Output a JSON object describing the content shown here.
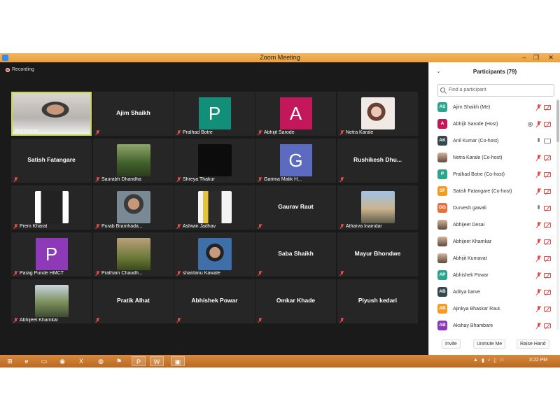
{
  "window": {
    "title": "Zoom Meeting",
    "minimize": "–",
    "maximize": "❐",
    "close": "✕"
  },
  "meeting": {
    "recording_label": "Recording"
  },
  "tiles": [
    {
      "label": "Anil Kumar",
      "type": "photo",
      "style": "man",
      "active": true
    },
    {
      "label": "",
      "big_name": "Ajim Shaikh",
      "type": "name"
    },
    {
      "label": "Pralhad Botre",
      "type": "avatar",
      "initial": "P",
      "color": "#138f79"
    },
    {
      "label": "Abhijit Sarode",
      "type": "avatar",
      "initial": "A",
      "color": "#c2185b"
    },
    {
      "label": "Netra Karale",
      "type": "photo",
      "style": "girl"
    },
    {
      "label": "",
      "big_name": "Satish Fatangare",
      "type": "name"
    },
    {
      "label": "Saurabh Dhandha",
      "type": "photo",
      "style": "park"
    },
    {
      "label": "Shreya Thakur",
      "type": "photo",
      "style": "dark"
    },
    {
      "label": "Garima Malik H...",
      "type": "avatar",
      "initial": "G",
      "color": "#5c6bc0"
    },
    {
      "label": "",
      "big_name": "Rushikesh  Dhu...",
      "type": "name"
    },
    {
      "label": "Prem Kharat",
      "type": "photo",
      "style": "bw"
    },
    {
      "label": "Purab Bramhada...",
      "type": "photo",
      "style": "boy"
    },
    {
      "label": "Ashwin Jadhav",
      "type": "photo",
      "style": "yellow"
    },
    {
      "label": "",
      "big_name": "Gaurav Raut",
      "type": "name"
    },
    {
      "label": "Atharva  Inamdar",
      "type": "photo",
      "style": "sky"
    },
    {
      "label": "Parag Punde HMCT",
      "type": "avatar",
      "initial": "P",
      "color": "#8e3ab8"
    },
    {
      "label": "Pratham Chaudh...",
      "type": "photo",
      "style": "out"
    },
    {
      "label": "shantanu Kawale",
      "type": "photo",
      "style": "blue"
    },
    {
      "label": "",
      "big_name": "Saba Shaikh",
      "type": "name"
    },
    {
      "label": "",
      "big_name": "Mayur Bhondwe",
      "type": "name"
    },
    {
      "label": "Abhijeet Khamkar",
      "type": "photo",
      "style": "bike"
    },
    {
      "label": "",
      "big_name": "Pratik Alhat",
      "type": "name"
    },
    {
      "label": "",
      "big_name": "Abhishek Powar",
      "type": "name"
    },
    {
      "label": "",
      "big_name": "Omkar Khade",
      "type": "name"
    },
    {
      "label": "",
      "big_name": "Piyush kedari",
      "type": "name"
    }
  ],
  "panel": {
    "title": "Participants (79)",
    "collapse_icon": "chevron-down-icon",
    "search_placeholder": "Find a participant",
    "participants": [
      {
        "initials": "AS",
        "color": "#2ca58d",
        "name": "Ajim Shaikh (Me)",
        "mic": "off",
        "cam": "off"
      },
      {
        "initials": "A",
        "color": "#c2185b",
        "name": "Abhijit Sarode (Host)",
        "mic": "off",
        "cam": "off",
        "rec": true
      },
      {
        "initials": "AK",
        "color": "#37474f",
        "name": "Anil Kumar (Co-host)",
        "mic": "on",
        "cam": "on"
      },
      {
        "initials": "",
        "color": "",
        "name": "Netra Karale (Co-host)",
        "mic": "off",
        "cam": "off",
        "img": true
      },
      {
        "initials": "P",
        "color": "#2ca58d",
        "name": "Pralhad Botre (Co-host)",
        "mic": "off",
        "cam": "off"
      },
      {
        "initials": "SF",
        "color": "#f39c24",
        "name": "Satish Fatangare (Co-host)",
        "mic": "off",
        "cam": "off"
      },
      {
        "initials": "DG",
        "color": "#e8703a",
        "name": "Durvesh gawali",
        "mic": "on",
        "cam": "off"
      },
      {
        "initials": "",
        "color": "",
        "name": "Abhijeet Desai",
        "mic": "off",
        "cam": "off",
        "img": true
      },
      {
        "initials": "",
        "color": "",
        "name": "Abhijeet Khamkar",
        "mic": "off",
        "cam": "off",
        "img": true
      },
      {
        "initials": "",
        "color": "",
        "name": "Abhijit Kumavat",
        "mic": "off",
        "cam": "off",
        "img": true
      },
      {
        "initials": "AP",
        "color": "#2ca58d",
        "name": "Abhishek Powar",
        "mic": "off",
        "cam": "off"
      },
      {
        "initials": "AB",
        "color": "#37474f",
        "name": "Aditya barve",
        "mic": "off",
        "cam": "off"
      },
      {
        "initials": "AB",
        "color": "#f39c24",
        "name": "Ajinkya Bhaskar Raut.",
        "mic": "off",
        "cam": "off"
      },
      {
        "initials": "AB",
        "color": "#8e3ab8",
        "name": "Akshay Bhambare",
        "mic": "off",
        "cam": "off"
      }
    ],
    "buttons": {
      "invite": "Invite",
      "unmute_me": "Unmute Me",
      "raise_hand": "Raise Hand"
    }
  },
  "taskbar": {
    "start_icon": "windows-start-icon",
    "apps": [
      {
        "icon": "ie-icon",
        "glyph": "e"
      },
      {
        "icon": "folder-icon",
        "glyph": "▭"
      },
      {
        "icon": "chrome-icon",
        "glyph": "◉"
      },
      {
        "icon": "excel-icon",
        "glyph": "X"
      },
      {
        "icon": "globe-icon",
        "glyph": "◍"
      },
      {
        "icon": "flag-icon",
        "glyph": "⚑"
      },
      {
        "icon": "powerpoint-icon",
        "glyph": "P"
      },
      {
        "icon": "word-icon",
        "glyph": "W"
      },
      {
        "icon": "zoom-icon",
        "glyph": "▣"
      }
    ],
    "clock": "3:22 PM"
  }
}
